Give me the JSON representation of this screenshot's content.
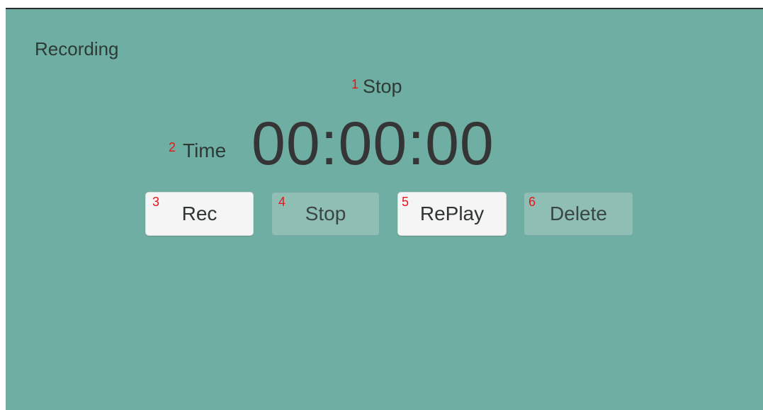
{
  "panel": {
    "title": "Recording"
  },
  "status": {
    "marker": "1",
    "text": "Stop"
  },
  "timer": {
    "marker": "2",
    "label": "Time",
    "value": "00:00:00"
  },
  "buttons": [
    {
      "marker": "3",
      "label": "Rec",
      "enabled": true
    },
    {
      "marker": "4",
      "label": "Stop",
      "enabled": false
    },
    {
      "marker": "5",
      "label": "RePlay",
      "enabled": true
    },
    {
      "marker": "6",
      "label": "Delete",
      "enabled": false
    }
  ],
  "colors": {
    "background": "#6faea2",
    "marker": "#e8141a",
    "button_active": "#f5f5f5",
    "button_disabled": "#8fbeb5"
  }
}
